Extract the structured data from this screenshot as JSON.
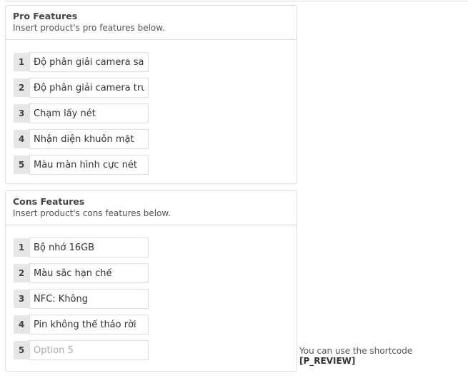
{
  "pro": {
    "title": "Pro Features",
    "description": "Insert product's pro features below.",
    "items": [
      {
        "n": "1",
        "value": "Độ phân giải camera sau"
      },
      {
        "n": "2",
        "value": "Độ phân giải camera trước"
      },
      {
        "n": "3",
        "value": "Chạm lấy nét"
      },
      {
        "n": "4",
        "value": "Nhận diện khuôn mặt"
      },
      {
        "n": "5",
        "value": "Màu màn hình cực nét"
      }
    ]
  },
  "cons": {
    "title": "Cons Features",
    "description": "Insert product's cons features below.",
    "items": [
      {
        "n": "1",
        "value": "Bộ nhớ 16GB"
      },
      {
        "n": "2",
        "value": "Màu sắc hạn chế"
      },
      {
        "n": "3",
        "value": "NFC: Không"
      },
      {
        "n": "4",
        "value": "Pin không thể tháo rời"
      },
      {
        "n": "5",
        "value": "",
        "placeholder": "Option 5"
      }
    ]
  },
  "note": {
    "text": "You can use the shortcode ",
    "code": "[P_REVIEW]"
  }
}
